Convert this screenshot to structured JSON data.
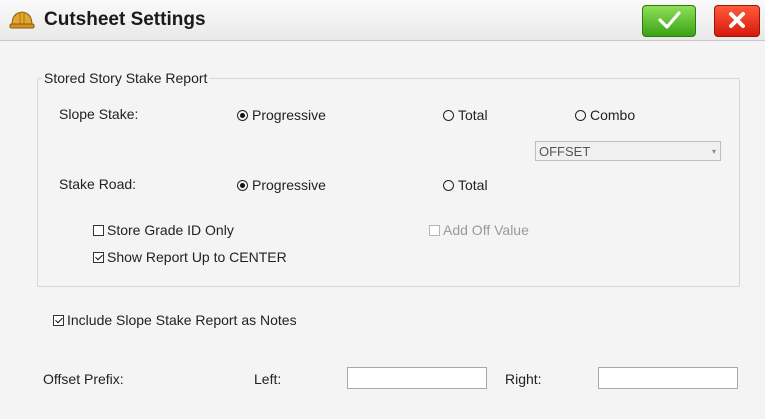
{
  "window": {
    "title": "Cutsheet Settings",
    "icon": "hard-hat-icon",
    "ok_icon": "checkmark-icon",
    "cancel_icon": "close-x-icon"
  },
  "report_group": {
    "legend": "Stored Story Stake Report",
    "slope_stake": {
      "label": "Slope Stake:",
      "options": [
        "Progressive",
        "Total",
        "Combo"
      ],
      "selected": "Progressive"
    },
    "combo_select": {
      "value": "OFFSET"
    },
    "stake_road": {
      "label": "Stake Road:",
      "options": [
        "Progressive",
        "Total"
      ],
      "selected": "Progressive"
    },
    "store_grade_id_only": {
      "label": "Store Grade ID Only",
      "checked": false
    },
    "add_off_value": {
      "label": "Add Off Value",
      "checked": false,
      "enabled": false
    },
    "show_report_up_to_center": {
      "label": "Show Report Up to CENTER",
      "checked": true
    }
  },
  "include_notes": {
    "label": "Include Slope Stake Report as Notes",
    "checked": true
  },
  "offset_prefix": {
    "label": "Offset Prefix:",
    "left_label": "Left:",
    "left_value": "",
    "right_label": "Right:",
    "right_value": ""
  },
  "colors": {
    "ok_green": "#39a314",
    "cancel_red": "#d8190d",
    "background": "#f4f4f4"
  }
}
